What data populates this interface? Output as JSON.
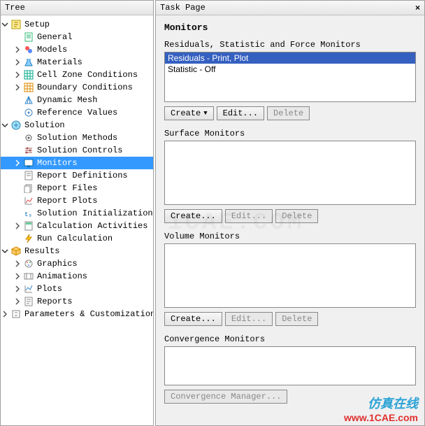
{
  "left": {
    "title": "Tree"
  },
  "right": {
    "title": "Task Page"
  },
  "tree": {
    "setup": "Setup",
    "general": "General",
    "models": "Models",
    "materials": "Materials",
    "cellzone": "Cell Zone Conditions",
    "boundary": "Boundary Conditions",
    "dynmesh": "Dynamic Mesh",
    "refvals": "Reference Values",
    "solution": "Solution",
    "methods": "Solution Methods",
    "controls": "Solution Controls",
    "monitors": "Monitors",
    "reportdef": "Report Definitions",
    "reportfiles": "Report Files",
    "reportplots": "Report Plots",
    "init": "Solution Initialization",
    "calcact": "Calculation Activities",
    "runcalc": "Run Calculation",
    "results": "Results",
    "graphics": "Graphics",
    "anim": "Animations",
    "plots": "Plots",
    "reports": "Reports",
    "params": "Parameters & Customization"
  },
  "task": {
    "title": "Monitors",
    "sections": {
      "residuals": {
        "label": "Residuals, Statistic and Force Monitors",
        "items": [
          "Residuals - Print, Plot",
          "Statistic - Off"
        ]
      },
      "surface": {
        "label": "Surface Monitors"
      },
      "volume": {
        "label": "Volume Monitors"
      },
      "conv": {
        "label": "Convergence Monitors"
      }
    },
    "buttons": {
      "create_dd": "Create",
      "create": "Create...",
      "edit": "Edit...",
      "delete": "Delete",
      "convmgr": "Convergence Manager..."
    }
  },
  "wm": {
    "cn": "仿真在线",
    "url": "www.1CAE.com"
  },
  "faint": "1CAE.COM"
}
